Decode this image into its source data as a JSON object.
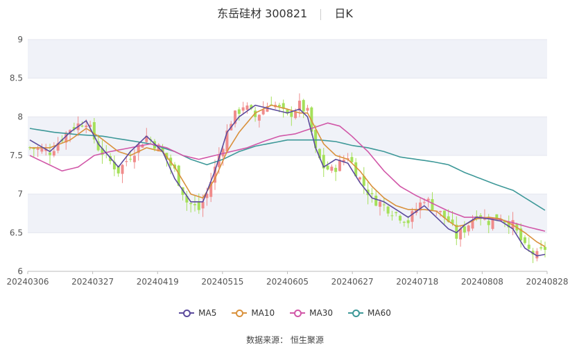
{
  "header": {
    "stock_name": "东岳硅材 300821",
    "period": "日K"
  },
  "source": "数据来源： 恒生聚源",
  "colors": {
    "up": "#f08c8c",
    "down": "#a5e05a",
    "grid_band": "#f0f2f8",
    "ma5": "#5b4a9c",
    "ma10": "#d9913c",
    "ma30": "#d157a8",
    "ma60": "#3d9898"
  },
  "chart_data": {
    "type": "candlestick",
    "ylim": [
      6,
      9
    ],
    "yticks": [
      "6",
      "6.5",
      "7",
      "7.5",
      "8",
      "8.5",
      "9"
    ],
    "xticks": [
      "20240306",
      "20240327",
      "20240419",
      "20240515",
      "20240605",
      "20240627",
      "20240718",
      "20240808",
      "20240828"
    ],
    "legend": [
      "MA5",
      "MA10",
      "MA30",
      "MA60"
    ],
    "grid": true,
    "legend_position": "bottom",
    "close_keyframes": [
      [
        0,
        7.6
      ],
      [
        5,
        7.55
      ],
      [
        10,
        7.85
      ],
      [
        14,
        7.95
      ],
      [
        17,
        7.6
      ],
      [
        22,
        7.3
      ],
      [
        25,
        7.5
      ],
      [
        29,
        7.75
      ],
      [
        32,
        7.6
      ],
      [
        36,
        7.3
      ],
      [
        39,
        6.9
      ],
      [
        42,
        6.8
      ],
      [
        44,
        7.0
      ],
      [
        47,
        7.5
      ],
      [
        50,
        7.95
      ],
      [
        53,
        8.15
      ],
      [
        56,
        8.0
      ],
      [
        60,
        8.2
      ],
      [
        64,
        8.0
      ],
      [
        67,
        8.15
      ],
      [
        69,
        8.05
      ],
      [
        71,
        7.55
      ],
      [
        73,
        7.35
      ],
      [
        75,
        7.3
      ],
      [
        79,
        7.5
      ],
      [
        82,
        7.2
      ],
      [
        85,
        6.95
      ],
      [
        88,
        6.85
      ],
      [
        91,
        6.75
      ],
      [
        94,
        6.65
      ],
      [
        98,
        6.95
      ],
      [
        101,
        6.8
      ],
      [
        104,
        6.65
      ],
      [
        106,
        6.45
      ],
      [
        108,
        6.55
      ],
      [
        111,
        6.75
      ],
      [
        114,
        6.65
      ],
      [
        117,
        6.7
      ],
      [
        120,
        6.6
      ],
      [
        123,
        6.3
      ],
      [
        126,
        6.2
      ],
      [
        128,
        6.3
      ]
    ],
    "ma_keyframes": {
      "MA5": [
        [
          0,
          7.7
        ],
        [
          5,
          7.55
        ],
        [
          10,
          7.8
        ],
        [
          14,
          7.95
        ],
        [
          17,
          7.65
        ],
        [
          22,
          7.35
        ],
        [
          25,
          7.55
        ],
        [
          29,
          7.75
        ],
        [
          33,
          7.55
        ],
        [
          36,
          7.2
        ],
        [
          40,
          6.9
        ],
        [
          43,
          6.9
        ],
        [
          46,
          7.3
        ],
        [
          49,
          7.8
        ],
        [
          52,
          8.0
        ],
        [
          56,
          8.15
        ],
        [
          60,
          8.1
        ],
        [
          64,
          8.05
        ],
        [
          67,
          8.1
        ],
        [
          69,
          8.0
        ],
        [
          71,
          7.6
        ],
        [
          73,
          7.35
        ],
        [
          76,
          7.45
        ],
        [
          79,
          7.4
        ],
        [
          82,
          7.15
        ],
        [
          85,
          6.95
        ],
        [
          88,
          6.9
        ],
        [
          91,
          6.8
        ],
        [
          94,
          6.7
        ],
        [
          98,
          6.85
        ],
        [
          101,
          6.7
        ],
        [
          104,
          6.55
        ],
        [
          106,
          6.5
        ],
        [
          108,
          6.6
        ],
        [
          111,
          6.7
        ],
        [
          114,
          6.68
        ],
        [
          117,
          6.65
        ],
        [
          120,
          6.55
        ],
        [
          123,
          6.3
        ],
        [
          126,
          6.2
        ],
        [
          128,
          6.22
        ]
      ],
      "MA10": [
        [
          0,
          7.6
        ],
        [
          5,
          7.6
        ],
        [
          10,
          7.7
        ],
        [
          14,
          7.85
        ],
        [
          17,
          7.75
        ],
        [
          22,
          7.55
        ],
        [
          25,
          7.5
        ],
        [
          29,
          7.6
        ],
        [
          33,
          7.55
        ],
        [
          36,
          7.35
        ],
        [
          40,
          7.0
        ],
        [
          43,
          6.95
        ],
        [
          46,
          7.2
        ],
        [
          49,
          7.55
        ],
        [
          52,
          7.8
        ],
        [
          56,
          8.05
        ],
        [
          60,
          8.15
        ],
        [
          64,
          8.1
        ],
        [
          67,
          8.05
        ],
        [
          69,
          8.05
        ],
        [
          71,
          7.85
        ],
        [
          73,
          7.65
        ],
        [
          76,
          7.5
        ],
        [
          79,
          7.45
        ],
        [
          82,
          7.3
        ],
        [
          85,
          7.1
        ],
        [
          88,
          6.95
        ],
        [
          91,
          6.85
        ],
        [
          94,
          6.8
        ],
        [
          98,
          6.8
        ],
        [
          101,
          6.78
        ],
        [
          104,
          6.65
        ],
        [
          106,
          6.58
        ],
        [
          108,
          6.6
        ],
        [
          111,
          6.68
        ],
        [
          114,
          6.7
        ],
        [
          117,
          6.68
        ],
        [
          120,
          6.6
        ],
        [
          123,
          6.5
        ],
        [
          126,
          6.38
        ],
        [
          128,
          6.32
        ]
      ],
      "MA30": [
        [
          0,
          7.5
        ],
        [
          4,
          7.4
        ],
        [
          8,
          7.3
        ],
        [
          12,
          7.35
        ],
        [
          16,
          7.5
        ],
        [
          20,
          7.55
        ],
        [
          25,
          7.6
        ],
        [
          30,
          7.65
        ],
        [
          34,
          7.6
        ],
        [
          38,
          7.5
        ],
        [
          42,
          7.45
        ],
        [
          46,
          7.5
        ],
        [
          50,
          7.55
        ],
        [
          54,
          7.6
        ],
        [
          58,
          7.68
        ],
        [
          62,
          7.75
        ],
        [
          66,
          7.78
        ],
        [
          70,
          7.85
        ],
        [
          74,
          7.92
        ],
        [
          77,
          7.88
        ],
        [
          80,
          7.75
        ],
        [
          84,
          7.55
        ],
        [
          88,
          7.3
        ],
        [
          92,
          7.1
        ],
        [
          96,
          6.98
        ],
        [
          100,
          6.88
        ],
        [
          104,
          6.78
        ],
        [
          108,
          6.7
        ],
        [
          112,
          6.7
        ],
        [
          116,
          6.68
        ],
        [
          120,
          6.63
        ],
        [
          124,
          6.57
        ],
        [
          128,
          6.52
        ]
      ],
      "MA60": [
        [
          0,
          7.85
        ],
        [
          6,
          7.8
        ],
        [
          12,
          7.77
        ],
        [
          18,
          7.75
        ],
        [
          24,
          7.7
        ],
        [
          30,
          7.65
        ],
        [
          36,
          7.55
        ],
        [
          40,
          7.45
        ],
        [
          44,
          7.38
        ],
        [
          48,
          7.45
        ],
        [
          52,
          7.55
        ],
        [
          56,
          7.62
        ],
        [
          60,
          7.66
        ],
        [
          64,
          7.7
        ],
        [
          68,
          7.7
        ],
        [
          72,
          7.7
        ],
        [
          76,
          7.68
        ],
        [
          80,
          7.63
        ],
        [
          84,
          7.6
        ],
        [
          88,
          7.55
        ],
        [
          92,
          7.48
        ],
        [
          96,
          7.45
        ],
        [
          100,
          7.42
        ],
        [
          104,
          7.38
        ],
        [
          108,
          7.28
        ],
        [
          112,
          7.2
        ],
        [
          116,
          7.12
        ],
        [
          120,
          7.05
        ],
        [
          124,
          6.92
        ],
        [
          128,
          6.79
        ]
      ]
    }
  }
}
